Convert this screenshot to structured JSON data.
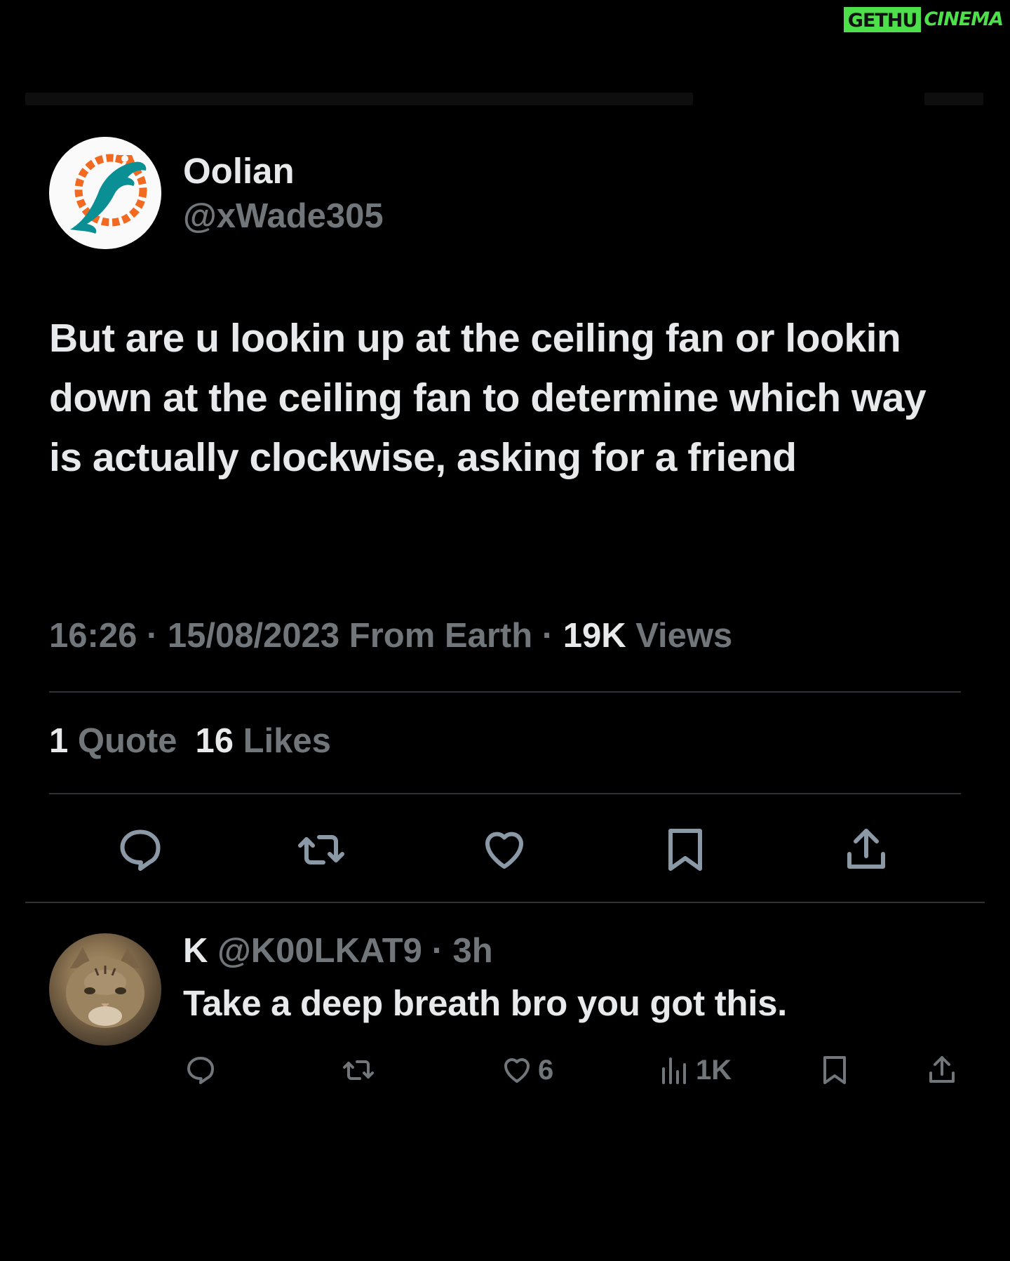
{
  "watermark": {
    "left": "GETHU",
    "right": "CINEMA"
  },
  "tweet": {
    "author_name": "Oolian",
    "author_handle": "@xWade305",
    "text": "But are u lookin up at the ceiling fan or lookin down at the ceiling fan to determine which way is actually clockwise, asking for a friend",
    "time": "16:26",
    "date": "15/08/2023",
    "source": "From Earth",
    "views_count": "19K",
    "views_label": "Views",
    "quotes_count": "1",
    "quotes_label": "Quote",
    "likes_count": "16",
    "likes_label": "Likes",
    "actions": [
      "reply-icon",
      "retweet-icon",
      "like-icon",
      "bookmark-icon",
      "share-icon"
    ]
  },
  "reply": {
    "name": "K",
    "handle": "@K00LKAT9",
    "time": "3h",
    "text": "Take a deep breath bro you got this.",
    "likes": "6",
    "views": "1K"
  },
  "colors": {
    "background": "#000000",
    "primary_text": "#e7e9ea",
    "secondary_text": "#71767b",
    "divider": "#2f3336",
    "watermark_green": "#4ee04a"
  }
}
